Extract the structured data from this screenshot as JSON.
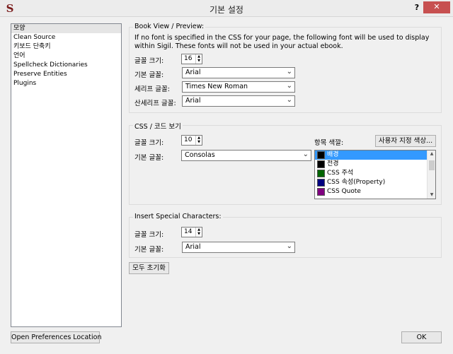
{
  "window": {
    "title": "기본 설정",
    "help": "?",
    "close": "✕",
    "app_icon": "S"
  },
  "sidebar": {
    "items": [
      {
        "label": "모양"
      },
      {
        "label": "Clean Source"
      },
      {
        "label": "키보드 단축키"
      },
      {
        "label": "언어"
      },
      {
        "label": "Spellcheck Dictionaries"
      },
      {
        "label": "Preserve Entities"
      },
      {
        "label": "Plugins"
      }
    ]
  },
  "book_view": {
    "title": "Book View / Preview:",
    "note": "If no font is specified in the CSS for your page, the following font will be used to display within Sigil. These fonts will not be used in your actual ebook.",
    "font_size_label": "글꼴 크기:",
    "font_size": "16",
    "standard_font_label": "기본 글꼴:",
    "standard_font": "Arial",
    "serif_font_label": "세리프 글꼴:",
    "serif_font": "Times New Roman",
    "sans_serif_font_label": "산세리프 글꼴:",
    "sans_serif_font": "Arial"
  },
  "css_code_view": {
    "title": "CSS / 코드 보기",
    "font_size_label": "글꼴 크기:",
    "font_size": "10",
    "standard_font_label": "기본 글꼴:",
    "standard_font": "Consolas",
    "item_color_label": "항목 색깔:",
    "custom_color_button": "사용자 지정 색상...",
    "color_items": [
      {
        "label": "배경",
        "color": "#000000"
      },
      {
        "label": "전경",
        "color": "#000000"
      },
      {
        "label": "CSS 주석",
        "color": "#006400"
      },
      {
        "label": "CSS 속성(Property)",
        "color": "#000080"
      },
      {
        "label": "CSS Quote",
        "color": "#800080"
      }
    ]
  },
  "special_chars": {
    "title": "Insert Special Characters:",
    "font_size_label": "글꼴 크기:",
    "font_size": "14",
    "standard_font_label": "기본 글꼴:",
    "standard_font": "Arial"
  },
  "buttons": {
    "reset_all": "모두 초기화",
    "open_prefs_location": "Open Preferences Location",
    "ok": "OK"
  }
}
